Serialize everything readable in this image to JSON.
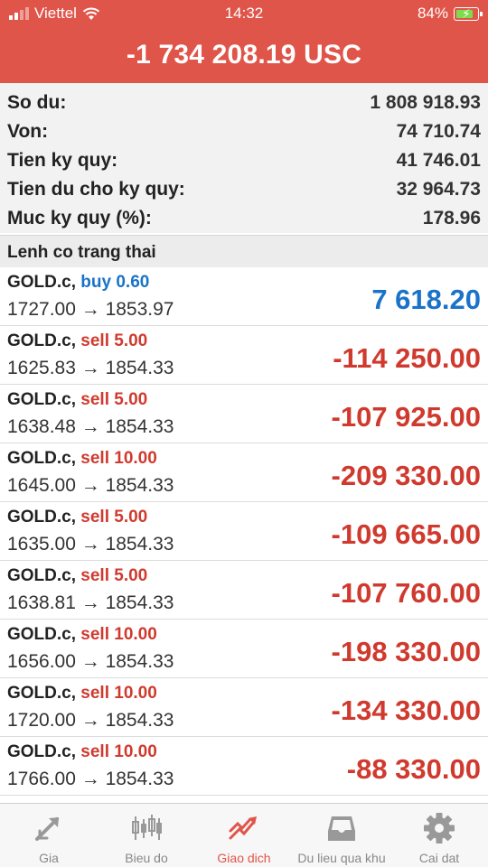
{
  "status_bar": {
    "carrier": "Viettel",
    "time": "14:32",
    "battery": "84%"
  },
  "header": {
    "total": "-1 734 208.19 USC"
  },
  "summary": [
    {
      "label": "So du:",
      "value": "1 808 918.93"
    },
    {
      "label": "Von:",
      "value": "74 710.74"
    },
    {
      "label": "Tien ky quy:",
      "value": "41 746.01"
    },
    {
      "label": "Tien du cho ky quy:",
      "value": "32 964.73"
    },
    {
      "label": "Muc ky quy (%):",
      "value": "178.96"
    }
  ],
  "section_title": "Lenh co trang thai",
  "positions": [
    {
      "symbol": "GOLD.c,",
      "side": "buy 0.60",
      "prices": "1727.00 → 1853.97",
      "profit": "7 618.20",
      "direction": "buy"
    },
    {
      "symbol": "GOLD.c,",
      "side": "sell 5.00",
      "prices": "1625.83 → 1854.33",
      "profit": "-114 250.00",
      "direction": "sell"
    },
    {
      "symbol": "GOLD.c,",
      "side": "sell 5.00",
      "prices": "1638.48 → 1854.33",
      "profit": "-107 925.00",
      "direction": "sell"
    },
    {
      "symbol": "GOLD.c,",
      "side": "sell 10.00",
      "prices": "1645.00 → 1854.33",
      "profit": "-209 330.00",
      "direction": "sell"
    },
    {
      "symbol": "GOLD.c,",
      "side": "sell 5.00",
      "prices": "1635.00 → 1854.33",
      "profit": "-109 665.00",
      "direction": "sell"
    },
    {
      "symbol": "GOLD.c,",
      "side": "sell 5.00",
      "prices": "1638.81 → 1854.33",
      "profit": "-107 760.00",
      "direction": "sell"
    },
    {
      "symbol": "GOLD.c,",
      "side": "sell 10.00",
      "prices": "1656.00 → 1854.33",
      "profit": "-198 330.00",
      "direction": "sell"
    },
    {
      "symbol": "GOLD.c,",
      "side": "sell 10.00",
      "prices": "1720.00 → 1854.33",
      "profit": "-134 330.00",
      "direction": "sell"
    },
    {
      "symbol": "GOLD.c,",
      "side": "sell 10.00",
      "prices": "1766.00 → 1854.33",
      "profit": "-88 330.00",
      "direction": "sell"
    }
  ],
  "tabs": [
    {
      "label": "Gia",
      "icon": "quotes-arrows-icon",
      "active": false
    },
    {
      "label": "Bieu do",
      "icon": "candlestick-chart-icon",
      "active": false
    },
    {
      "label": "Giao dich",
      "icon": "trade-trend-icon",
      "active": true
    },
    {
      "label": "Du lieu qua khu",
      "icon": "history-inbox-icon",
      "active": false
    },
    {
      "label": "Cai dat",
      "icon": "gear-icon",
      "active": false
    }
  ],
  "colors": {
    "header": "#e0554a",
    "buy": "#1a73c8",
    "sell": "#d03a2e",
    "active_tab": "#e0554a"
  }
}
